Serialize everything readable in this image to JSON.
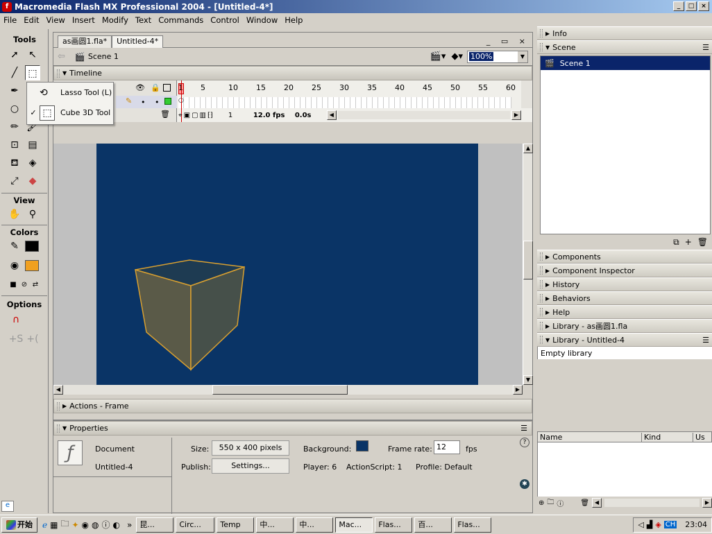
{
  "window": {
    "title": "Macromedia Flash MX Professional 2004 - [Untitled-4*]",
    "app_icon": "f",
    "minimize": "_",
    "maximize": "□",
    "close": "×"
  },
  "menu": [
    "File",
    "Edit",
    "View",
    "Insert",
    "Modify",
    "Text",
    "Commands",
    "Control",
    "Window",
    "Help"
  ],
  "tools": {
    "title": "Tools",
    "view_title": "View",
    "colors_title": "Colors",
    "options_title": "Options",
    "stroke_color": "#000000",
    "fill_color": "#f0a020"
  },
  "flyout": {
    "items": [
      {
        "label": "Lasso Tool (L)",
        "icon": "lasso-icon",
        "checked": false
      },
      {
        "label": "Cube 3D Tool",
        "icon": "cube-icon",
        "checked": true
      }
    ],
    "check": "✓"
  },
  "document": {
    "tabs": [
      "as画圆1.fla*",
      "Untitled-4*"
    ],
    "scene": "Scene 1",
    "zoom": "100%",
    "timeline_title": "Timeline",
    "frame_numbers": [
      "1",
      "5",
      "10",
      "15",
      "20",
      "25",
      "30",
      "35",
      "40",
      "45",
      "50",
      "55",
      "60"
    ],
    "current_frame": "1",
    "fps": "12.0 fps",
    "elapsed": "0.0s",
    "stage_color": "#0a3466"
  },
  "actions_panel": {
    "title": "Actions - Frame"
  },
  "properties": {
    "title": "Properties",
    "doc_label": "Document",
    "doc_name": "Untitled-4",
    "size_label": "Size:",
    "size_value": "550 x 400 pixels",
    "publish_label": "Publish:",
    "settings_btn": "Settings...",
    "bg_label": "Background:",
    "bg_color": "#0a3466",
    "framerate_label": "Frame rate:",
    "framerate_value": "12",
    "fps_unit": "fps",
    "player": "Player: 6",
    "actionscript": "ActionScript: 1",
    "profile": "Profile:  Default"
  },
  "right_panels": {
    "info": "Info",
    "scene": "Scene",
    "scene_item": "Scene 1",
    "collapsed": [
      "Components",
      "Component Inspector",
      "History",
      "Behaviors",
      "Help",
      "Library - as画圆1.fla"
    ],
    "library": "Library - Untitled-4",
    "library_empty": "Empty library",
    "columns": [
      "Name",
      "Kind",
      "Us"
    ]
  },
  "taskbar": {
    "start": "开始",
    "tasks": [
      "昆...",
      "Circ...",
      "Temp",
      "中...",
      "中...",
      "Mac...",
      "Flas...",
      "百...",
      "Flas..."
    ],
    "active_index": 5,
    "ime": "CH",
    "clock": "23:04"
  }
}
